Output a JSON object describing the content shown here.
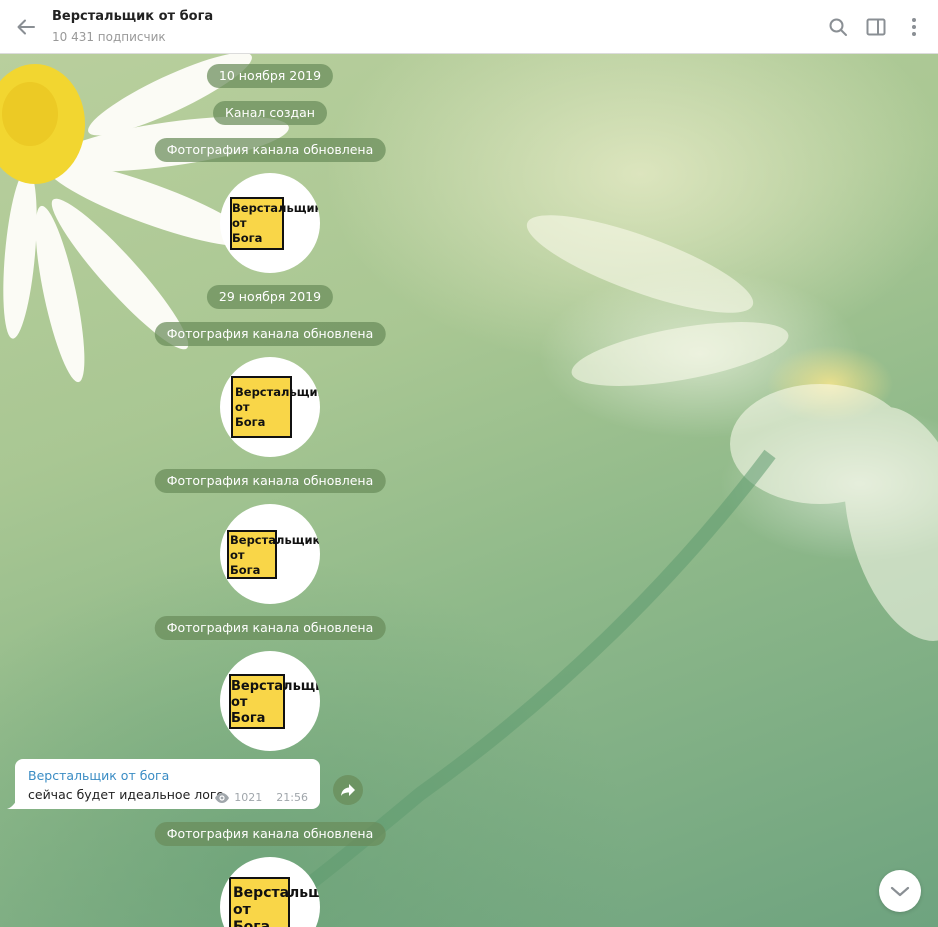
{
  "header": {
    "title": "Верстальщик от бога",
    "subtitle": "10 431 подписчик",
    "icons": [
      "back-arrow-icon",
      "search-icon",
      "sidebar-toggle-icon",
      "more-vertical-icon"
    ]
  },
  "chat": {
    "date1": "10 ноября 2019",
    "created": "Канал создан",
    "photo_updated": "Фотография канала обновлена",
    "date2": "29 ноября 2019",
    "logo_line1": "Верстальщик",
    "logo_line2": "от",
    "logo_line3": "Бога",
    "logo_line1_cut": "Верстальщ",
    "message": {
      "author": "Верстальщик от бога",
      "text": "сейчас будет идеальное лого",
      "views": "1021",
      "time": "21:56"
    }
  },
  "colors": {
    "accent": "#3a8cc4",
    "service_pill": "#698c5a",
    "logo_yellow": "#f9d648"
  }
}
